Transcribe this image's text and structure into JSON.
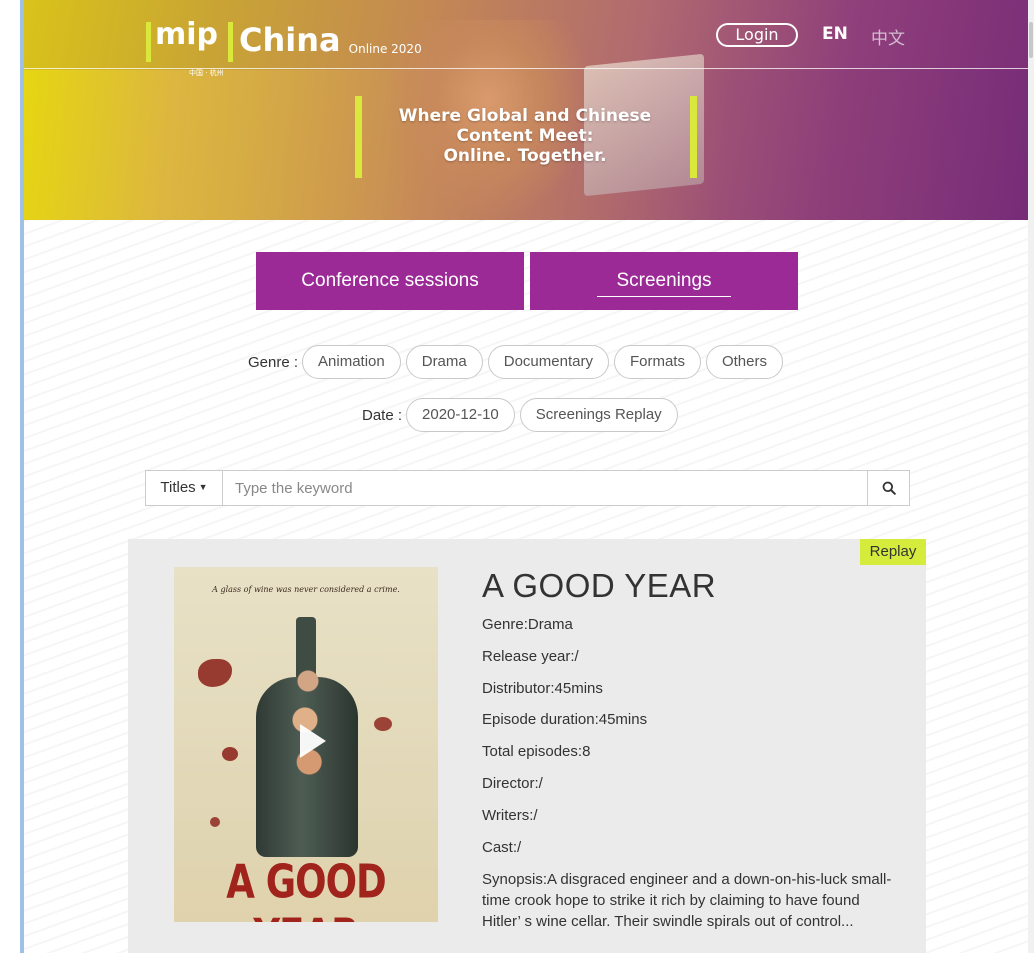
{
  "header": {
    "logo_mip": "mip",
    "logo_sub": "中国 · 杭州",
    "logo_china": "China",
    "logo_edition": "Online 2020",
    "login_label": "Login",
    "lang_en": "EN",
    "lang_zh": "中文",
    "tagline_line1": "Where Global and Chinese",
    "tagline_line2": "Content Meet:",
    "tagline_line3": "Online. Together."
  },
  "tabs": {
    "conference": "Conference sessions",
    "screenings": "Screenings"
  },
  "filters": {
    "genre_label": "Genre :",
    "genres": [
      "Animation",
      "Drama",
      "Documentary",
      "Formats",
      "Others"
    ],
    "date_label": "Date :",
    "dates": [
      "2020-12-10",
      "Screenings Replay"
    ]
  },
  "search": {
    "dropdown_label": "Titles",
    "placeholder": "Type the keyword",
    "icon": "search-icon"
  },
  "card": {
    "badge": "Replay",
    "title": "A GOOD YEAR",
    "genre": "Genre:Drama",
    "release_year": "Release year:/",
    "distributor": "Distributor:45mins",
    "episode_duration": "Episode duration:45mins",
    "total_episodes": "Total episodes:8",
    "director": "Director:/",
    "writers": "Writers:/",
    "cast": "Cast:/",
    "synopsis": "Synopsis:A disgraced engineer and a down-on-his-luck small-time crook hope to strike it rich by claiming to have found Hitler’ s wine cellar. Their swindle spirals out of control...",
    "poster": {
      "tagline": "A glass of wine was never considered a crime.",
      "title": "A GOOD YEAR",
      "play_icon": "play-icon"
    }
  },
  "colors": {
    "accent_purple": "#9b2a96",
    "accent_lime": "#d6ec3c",
    "card_bg": "#ebebeb"
  }
}
